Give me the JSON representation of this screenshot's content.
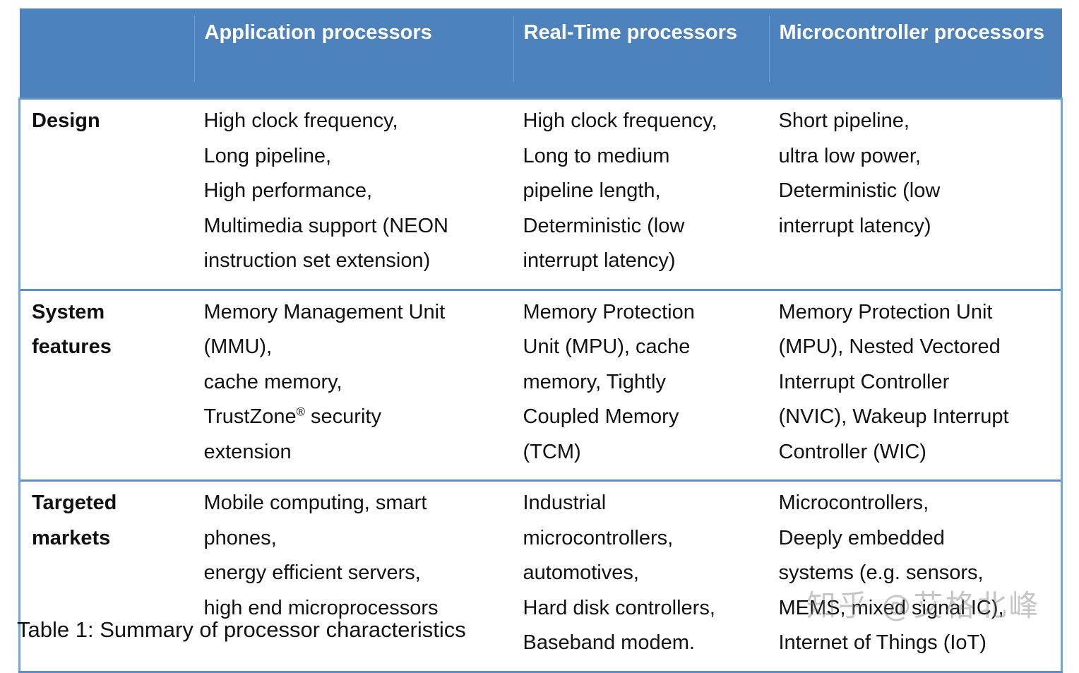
{
  "table": {
    "columns": [
      {
        "key": "row_label",
        "header": ""
      },
      {
        "key": "application",
        "header": "Application processors"
      },
      {
        "key": "realtime",
        "header": "Real-Time processors"
      },
      {
        "key": "microcontroller",
        "header": "Microcontroller processors"
      }
    ],
    "rows": [
      {
        "label": [
          "Design"
        ],
        "application": [
          "High clock frequency,",
          "Long pipeline,",
          "High performance,",
          "Multimedia support (NEON",
          "instruction set extension)"
        ],
        "realtime": [
          "High clock frequency,",
          "Long to medium",
          "pipeline length,",
          "Deterministic (low",
          "interrupt latency)"
        ],
        "microcontroller": [
          "Short pipeline,",
          "ultra low power,",
          "Deterministic (low",
          "interrupt latency)"
        ]
      },
      {
        "label": [
          "System",
          "features"
        ],
        "application": [
          "Memory Management Unit",
          "(MMU),",
          "cache memory,",
          "TrustZone® security",
          "extension"
        ],
        "realtime": [
          "Memory Protection",
          "Unit (MPU), cache",
          "memory, Tightly",
          "Coupled Memory",
          "(TCM)"
        ],
        "microcontroller": [
          "Memory Protection Unit",
          "(MPU), Nested Vectored",
          "Interrupt Controller",
          "(NVIC), Wakeup Interrupt",
          "Controller (WIC)"
        ]
      },
      {
        "label": [
          "Targeted",
          "markets"
        ],
        "application": [
          "Mobile computing, smart",
          "phones,",
          "energy efficient servers,",
          "high end microprocessors"
        ],
        "realtime": [
          "Industrial",
          "microcontrollers,",
          "automotives,",
          "Hard disk controllers,",
          "Baseband modem."
        ],
        "microcontroller": [
          "Microcontrollers,",
          "Deeply embedded",
          "systems (e.g. sensors,",
          "MEMS, mixed signal IC),",
          "Internet of Things (IoT)"
        ]
      }
    ]
  },
  "caption": "Table 1: Summary of processor characteristics",
  "watermark": "知乎 @艾格北峰",
  "colors": {
    "header_blue": "#4d82bd",
    "border_blue": "#5b8fc9",
    "header_text": "#ffffff",
    "body_text": "#111111",
    "page_background": "#ffffff"
  }
}
